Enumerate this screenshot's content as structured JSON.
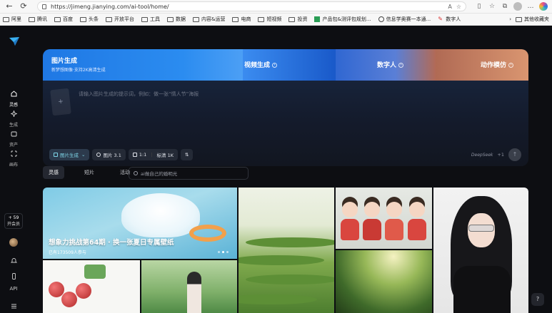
{
  "browser": {
    "url": "https://jimeng.jianying.com/ai-tool/home/",
    "bookmarks": [
      "阿里",
      "腾讯",
      "百度",
      "头条",
      "开放平台",
      "工具",
      "数据",
      "内容&运营",
      "电商",
      "短视频",
      "投资",
      "产品包&测评包规划...",
      "信息学奥赛一本通...",
      "数字人"
    ],
    "other_bookmarks": "其他收藏夹"
  },
  "sidebar": {
    "items": [
      {
        "label": "灵感"
      },
      {
        "label": "生成"
      },
      {
        "label": "资产"
      },
      {
        "label": "画布"
      }
    ],
    "plus": "+ 59",
    "member": "开会员",
    "api": "API"
  },
  "hero": {
    "title": "图片生成",
    "subtitle": "新梦想图像·支持2K高清生成",
    "video": "视频生成",
    "digital": "数字人",
    "motion": "动作模仿",
    "prompt": "请输入图片生成的提示词，例如：做一张“情人节”海报",
    "chips": {
      "mode": "图片生成",
      "model": "图片 3.1",
      "ratio": "1:1",
      "quality": "标清 1K"
    },
    "deepseek": "DeepSeek",
    "plus_one": "+1"
  },
  "tabs": [
    "灵感",
    "短片",
    "活动"
  ],
  "search": {
    "placeholder": "ai做自己的婚明光"
  },
  "banner": {
    "title": "想象力挑战第64期 · 换一张夏日专属壁纸",
    "participants": "已有173509人参与"
  },
  "colors": {
    "accent": "#2b8cf0",
    "background": "#0d0e12"
  }
}
